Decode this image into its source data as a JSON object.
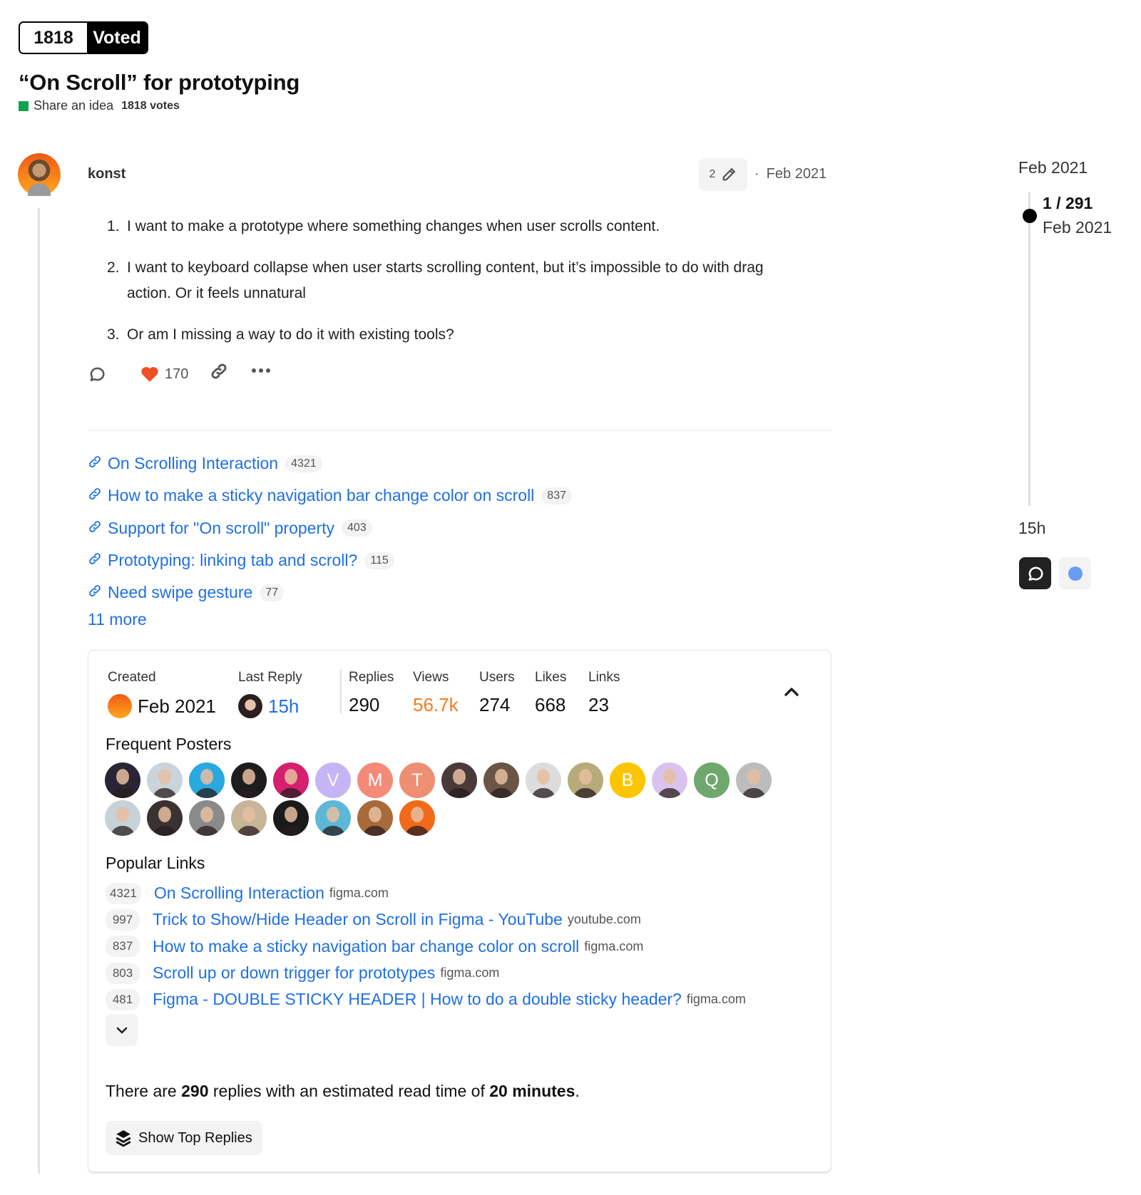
{
  "vote": {
    "count": "1818",
    "label": "Voted"
  },
  "topic": {
    "title": "“On Scroll” for prototyping",
    "category": "Share an idea",
    "category_color": "#12a150",
    "votes": "1818 votes"
  },
  "post": {
    "username": "konst",
    "edit_count": "2",
    "date": "Feb 2021",
    "date_sep": "·",
    "body": [
      {
        "num": "1.",
        "text": "I want to make a prototype where something changes when user scrolls content."
      },
      {
        "num": "2.",
        "text": "I want to keyboard collapse when user starts scrolling content, but it’s impossible to do with drag action. Or it feels unnatural"
      },
      {
        "num": "3.",
        "text": "Or am I missing a way to do it with existing tools?"
      }
    ],
    "likes": "170",
    "icons": {
      "reply": "reply-icon",
      "like": "heart-icon",
      "share": "link-icon",
      "more": "more-icon"
    }
  },
  "linked_topics": [
    {
      "title": "On Scrolling Interaction",
      "clicks": "4321"
    },
    {
      "title": "How to make a sticky navigation bar change color on scroll",
      "clicks": "837"
    },
    {
      "title": "Support for \"On scroll\" property",
      "clicks": "403"
    },
    {
      "title": "Prototyping: linking tab and scroll?",
      "clicks": "115"
    },
    {
      "title": "Need swipe gesture",
      "clicks": "77"
    }
  ],
  "more_links": "11 more",
  "summary": {
    "created_label": "Created",
    "created_value": "Feb 2021",
    "last_reply_label": "Last Reply",
    "last_reply_value": "15h",
    "stats": [
      {
        "label": "Replies",
        "value": "290"
      },
      {
        "label": "Views",
        "value": "56.7k",
        "color": "#f47c20"
      },
      {
        "label": "Users",
        "value": "274"
      },
      {
        "label": "Likes",
        "value": "668"
      },
      {
        "label": "Links",
        "value": "23"
      }
    ],
    "frequent_posters_heading": "Frequent Posters",
    "posters": [
      {
        "type": "photo",
        "bg": "#2a2535"
      },
      {
        "type": "photo",
        "bg": "#c9d4dc"
      },
      {
        "type": "photo",
        "bg": "#2aa8e0"
      },
      {
        "type": "photo",
        "bg": "#1d1d1d"
      },
      {
        "type": "photo",
        "bg": "#d61f6e"
      },
      {
        "type": "letter",
        "letter": "V",
        "bg": "#c5b5f5"
      },
      {
        "type": "letter",
        "letter": "M",
        "bg": "#f48a78"
      },
      {
        "type": "letter",
        "letter": "T",
        "bg": "#ee8e72"
      },
      {
        "type": "photo",
        "bg": "#4a3a3a"
      },
      {
        "type": "photo",
        "bg": "#6b5546"
      },
      {
        "type": "photo",
        "bg": "#dcdcdc"
      },
      {
        "type": "photo",
        "bg": "#b8ab7a"
      },
      {
        "type": "letter",
        "letter": "B",
        "bg": "#fdc500"
      },
      {
        "type": "photo",
        "bg": "#d9c3ee"
      },
      {
        "type": "letter",
        "letter": "Q",
        "bg": "#6fa86c"
      },
      {
        "type": "photo",
        "bg": "#bcbcbc"
      },
      {
        "type": "photo",
        "bg": "#c7d2d8"
      },
      {
        "type": "photo",
        "bg": "#3a3232"
      },
      {
        "type": "photo",
        "bg": "#8a8a8a"
      },
      {
        "type": "photo",
        "bg": "#c7b59a"
      },
      {
        "type": "photo",
        "bg": "#1a1a1a"
      },
      {
        "type": "photo",
        "bg": "#5cb8d6"
      },
      {
        "type": "photo",
        "bg": "#a86a3a"
      },
      {
        "type": "photo",
        "bg": "#f06a1a"
      }
    ],
    "popular_links_heading": "Popular Links",
    "popular_links": [
      {
        "count": "4321",
        "title": "On Scrolling Interaction",
        "domain": "figma.com"
      },
      {
        "count": "997",
        "title": "Trick to Show/Hide Header on Scroll in Figma - YouTube",
        "domain": "youtube.com"
      },
      {
        "count": "837",
        "title": "How to make a sticky navigation bar change color on scroll",
        "domain": "figma.com"
      },
      {
        "count": "803",
        "title": "Scroll up or down trigger for prototypes",
        "domain": "figma.com"
      },
      {
        "count": "481",
        "title": "Figma - DOUBLE STICKY HEADER | How to do a double sticky header?",
        "domain": "figma.com"
      }
    ],
    "read_time": {
      "prefix": "There are ",
      "replies": "290",
      "middle": " replies with an estimated read time of ",
      "duration": "20 minutes",
      "suffix": "."
    },
    "show_top_replies": "Show Top Replies"
  },
  "timeline": {
    "start_date": "Feb 2021",
    "position": "1 / 291",
    "position_date": "Feb 2021",
    "end_label": "15h"
  },
  "colors": {
    "link": "#1f6fe5",
    "heart": "#f04e23",
    "views": "#f47c20"
  }
}
